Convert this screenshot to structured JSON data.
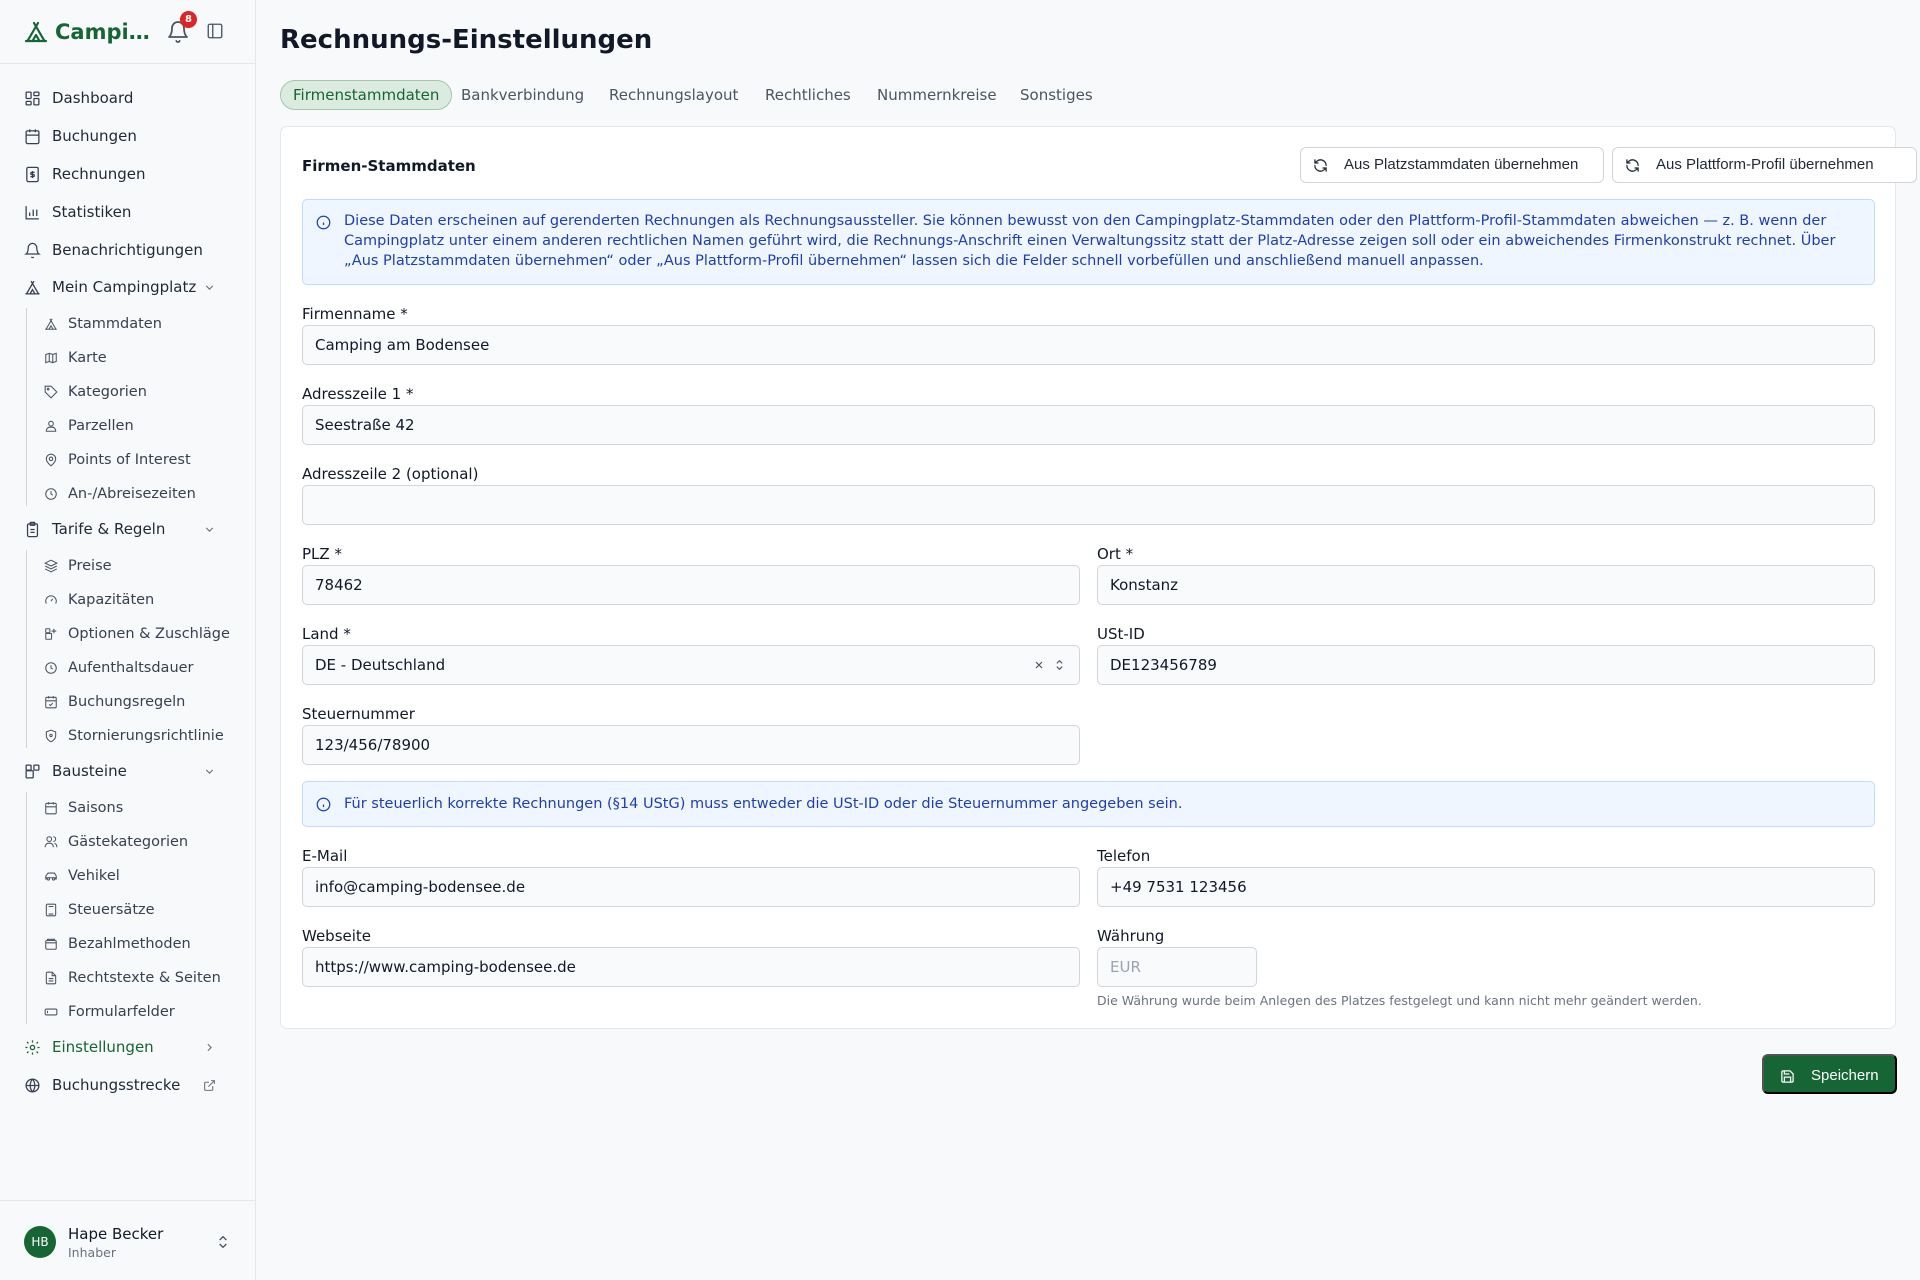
{
  "sidebar": {
    "brand": "Campingplatz",
    "notification_count": "8",
    "items": {
      "dashboard": "Dashboard",
      "buchungen": "Buchungen",
      "rechnungen": "Rechnungen",
      "statistiken": "Statistiken",
      "benachrichtigungen": "Benachrichtigungen",
      "mein_campingplatz": "Mein Campingplatz",
      "tarife": "Tarife & Regeln",
      "bausteine": "Bausteine",
      "einstellungen": "Einstellungen",
      "buchungsstrecke": "Buchungsstrecke"
    },
    "camp_sub": [
      "Stammdaten",
      "Karte",
      "Kategorien",
      "Parzellen",
      "Points of Interest",
      "An-/Abreisezeiten"
    ],
    "tarif_sub": [
      "Preise",
      "Kapazitäten",
      "Optionen & Zuschläge",
      "Aufenthaltsdauer",
      "Buchungsregeln",
      "Stornierungsrichtlinie"
    ],
    "bausteine_sub": [
      "Saisons",
      "Gästekategorien",
      "Vehikel",
      "Steuersätze",
      "Bezahlmethoden",
      "Rechtstexte & Seiten",
      "Formularfelder"
    ],
    "user": {
      "initials": "HB",
      "name": "Hape Becker",
      "role": "Inhaber"
    }
  },
  "page": {
    "title": "Rechnungs-Einstellungen",
    "tabs": [
      "Firmenstammdaten",
      "Bankverbindung",
      "Rechnungslayout",
      "Rechtliches",
      "Nummernkreise",
      "Sonstiges"
    ],
    "active_tab": "Firmenstammdaten"
  },
  "card": {
    "title": "Firmen-Stammdaten",
    "btn_platz": "Aus Platzstammdaten übernehmen",
    "btn_plattform": "Aus Plattform-Profil übernehmen",
    "info": "Diese Daten erscheinen auf gerenderten Rechnungen als Rechnungsaussteller. Sie können bewusst von den Campingplatz-Stammdaten oder den Plattform-Profil-Stammdaten abweichen — z. B. wenn der Campingplatz unter einem anderen rechtlichen Namen geführt wird, die Rechnungs-Anschrift einen Verwaltungssitz statt der Platz-Adresse zeigen soll oder ein abweichendes Firmenkonstrukt rechnet. Über „Aus Platzstammdaten übernehmen“ oder „Aus Plattform-Profil übernehmen“ lassen sich die Felder schnell vorbefüllen und anschließend manuell anpassen.",
    "tax_info": "Für steuerlich korrekte Rechnungen (§14 UStG) muss entweder die USt-ID oder die Steuernummer angegeben sein.",
    "currency_hint": "Die Währung wurde beim Anlegen des Platzes festgelegt und kann nicht mehr geändert werden."
  },
  "form": {
    "firmenname": {
      "label": "Firmenname *",
      "value": "Camping am Bodensee"
    },
    "adresse1": {
      "label": "Adresszeile 1 *",
      "value": "Seestraße 42"
    },
    "adresse2": {
      "label": "Adresszeile 2 (optional)",
      "value": ""
    },
    "plz": {
      "label": "PLZ *",
      "value": "78462"
    },
    "ort": {
      "label": "Ort *",
      "value": "Konstanz"
    },
    "land": {
      "label": "Land *",
      "value": "DE - Deutschland"
    },
    "ust_id": {
      "label": "USt-ID",
      "value": "DE123456789"
    },
    "steuernummer": {
      "label": "Steuernummer",
      "value": "123/456/78900"
    },
    "email": {
      "label": "E-Mail",
      "value": "info@camping-bodensee.de"
    },
    "telefon": {
      "label": "Telefon",
      "value": "+49 7531 123456"
    },
    "webseite": {
      "label": "Webseite",
      "value": "https://www.camping-bodensee.de"
    },
    "waehrung": {
      "label": "Währung",
      "value": "EUR"
    }
  },
  "actions": {
    "save": "Speichern"
  },
  "colors": {
    "brand": "#166534",
    "info_bg": "#eff6ff",
    "info_text": "#1e40af",
    "badge": "#dc2626"
  }
}
